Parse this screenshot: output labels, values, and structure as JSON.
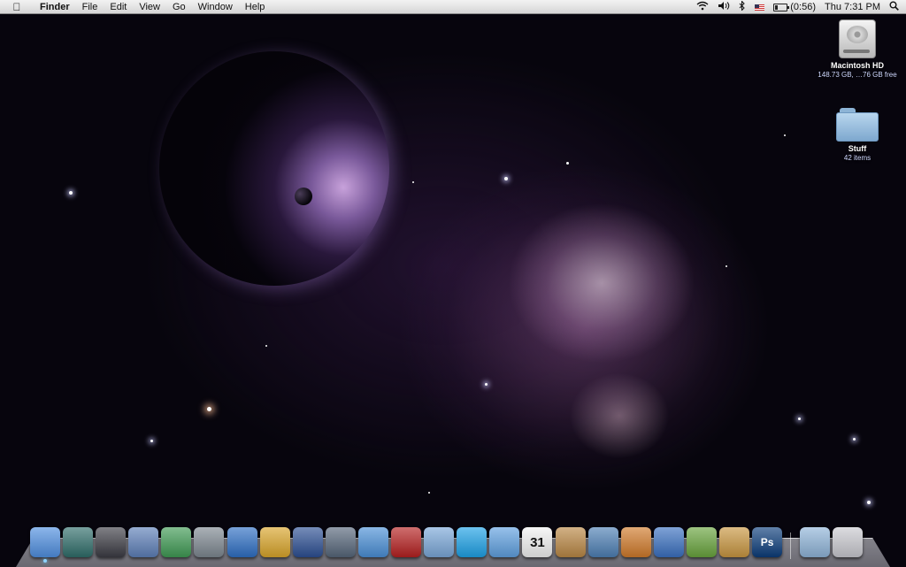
{
  "menubar": {
    "apple_icon": "apple-icon",
    "app_name": "Finder",
    "menus": [
      "File",
      "Edit",
      "View",
      "Go",
      "Window",
      "Help"
    ],
    "status": {
      "wifi_icon": "wifi-icon",
      "volume_icon": "volume-icon",
      "bluetooth_icon": "bluetooth-icon",
      "input_flag": "us-flag-icon",
      "battery_icon": "battery-icon",
      "battery_time": "(0:56)",
      "battery_fill": 0.2,
      "clock": "Thu 7:31 PM",
      "spotlight_icon": "spotlight-search-icon"
    }
  },
  "desktop": {
    "icons": [
      {
        "icon": "hard-drive-icon",
        "name": "Macintosh HD",
        "sub": "148.73 GB, …76 GB free"
      },
      {
        "icon": "folder-icon",
        "name": "Stuff",
        "sub": "42 items"
      }
    ]
  },
  "dock": {
    "apps": [
      {
        "icon": "finder-icon",
        "running": true,
        "color": "#4f8fe0"
      },
      {
        "icon": "time-machine-icon",
        "running": false,
        "color": "#2f6d6a"
      },
      {
        "icon": "aperture-icon",
        "running": false,
        "color": "#3c3c44"
      },
      {
        "icon": "keynote-icon",
        "running": false,
        "color": "#5d7fb8"
      },
      {
        "icon": "numbers-icon",
        "running": false,
        "color": "#3f9a54"
      },
      {
        "icon": "vmware-fusion-icon",
        "running": false,
        "color": "#7d8790"
      },
      {
        "icon": "pages-icon",
        "running": false,
        "color": "#2e6fc4"
      },
      {
        "icon": "garageband-shell-icon",
        "running": false,
        "color": "#d9a52a"
      },
      {
        "icon": "google-earth-icon",
        "running": false,
        "color": "#2c4f93"
      },
      {
        "icon": "preview-icon",
        "running": false,
        "color": "#56667a"
      },
      {
        "icon": "safari-icon",
        "running": false,
        "color": "#4a8fd6"
      },
      {
        "icon": "photo-booth-icon",
        "running": false,
        "color": "#b52020"
      },
      {
        "icon": "ichat-icon",
        "running": false,
        "color": "#7aa7d8"
      },
      {
        "icon": "skype-icon",
        "running": false,
        "color": "#1da1e6"
      },
      {
        "icon": "itunes-icon",
        "running": false,
        "color": "#5fa0e0"
      },
      {
        "icon": "ical-icon",
        "running": false,
        "color": "#f1f1f1",
        "label": "31"
      },
      {
        "icon": "address-book-icon",
        "running": false,
        "color": "#b98744"
      },
      {
        "icon": "iphoto-icon",
        "running": false,
        "color": "#4d7fb4"
      },
      {
        "icon": "garageband-guitar-icon",
        "running": false,
        "color": "#d07a2a"
      },
      {
        "icon": "imovie-icon",
        "running": false,
        "color": "#3a70c0"
      },
      {
        "icon": "iweb-icon",
        "running": false,
        "color": "#68a43d"
      },
      {
        "icon": "image-editor-icon",
        "running": false,
        "color": "#c89640"
      },
      {
        "icon": "photoshop-icon",
        "running": false,
        "color": "#0b3c7a",
        "label": "Ps"
      }
    ],
    "stacks": [
      {
        "icon": "documents-stack-icon",
        "color": "#8fb4d8"
      },
      {
        "icon": "trash-icon",
        "color": "#c9c9cf"
      }
    ]
  }
}
